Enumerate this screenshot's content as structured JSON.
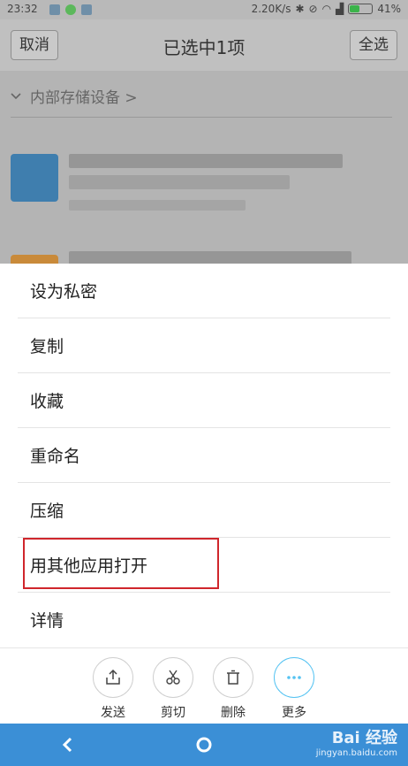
{
  "status_bar": {
    "time": "23:32",
    "network_speed": "2.20K/s",
    "battery": "41%",
    "battery_level": 0.41
  },
  "header": {
    "cancel_label": "取消",
    "title": "已选中1项",
    "select_all_label": "全选"
  },
  "breadcrumb": {
    "location": "内部存储设备 >"
  },
  "menu": {
    "items": [
      {
        "label": "设为私密"
      },
      {
        "label": "复制"
      },
      {
        "label": "收藏"
      },
      {
        "label": "重命名"
      },
      {
        "label": "压缩"
      },
      {
        "label": "用其他应用打开"
      },
      {
        "label": "详情"
      }
    ],
    "highlighted": "用其他应用打开"
  },
  "toolbar": {
    "send_label": "发送",
    "cut_label": "剪切",
    "delete_label": "删除",
    "more_label": "更多"
  },
  "watermark": {
    "brand": "Bai 经验",
    "url": "jingyan.baidu.com"
  },
  "colors": {
    "accent": "#55c3f2",
    "nav_bar": "#3b8fd6",
    "highlight_border": "#d0262c"
  },
  "icons": [
    "share-icon",
    "scissors-icon",
    "trash-icon",
    "more-dots-icon",
    "back-icon",
    "home-icon",
    "chevron-down-icon"
  ]
}
